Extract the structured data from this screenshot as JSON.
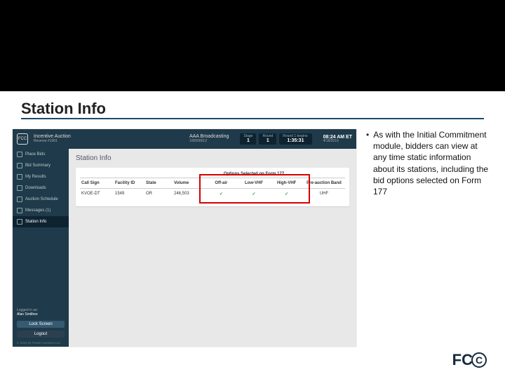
{
  "slide": {
    "heading": "Station Info",
    "bullet": "As with the Initial Commitment module, bidders can view at any time static information about its stations, including the bid options selected on Form 177"
  },
  "app": {
    "header": {
      "auction_name": "Incentive Auction",
      "auction_sub": "Reverse #1001",
      "bidder": "AAA Broadcasting",
      "bidder_sub": "100000012",
      "stage": {
        "label": "Stage",
        "value": "1"
      },
      "round": {
        "label": "Round",
        "value": "1"
      },
      "countdown": {
        "label": "Round 1 begins:",
        "value": "1:35:31"
      },
      "clock": {
        "value": "08:24 AM ET",
        "sub": "4/18/2016"
      }
    },
    "sidebar": {
      "items": [
        {
          "label": "Place Bids"
        },
        {
          "label": "Bid Summary"
        },
        {
          "label": "My Results"
        },
        {
          "label": "Downloads"
        },
        {
          "label": "Auction Schedule"
        },
        {
          "label": "Messages (1)"
        },
        {
          "label": "Station Info"
        }
      ],
      "logged_in_label": "Logged in as:",
      "logged_in_user": "Alan Smithee",
      "lock_btn": "Lock Screen",
      "logout_btn": "Logout",
      "footer": "© 2016 by Power Auctions LLC"
    },
    "main": {
      "title": "Station Info",
      "table": {
        "span_header": "Options Selected on Form 177",
        "headers": {
          "call_sign": "Call Sign",
          "facility_id": "Facility ID",
          "state": "State",
          "volume": "Volume",
          "off_air": "Off-air",
          "low_vhf": "Low-VHF",
          "high_vhf": "High-VHF",
          "pre_auction_band": "Pre-auction Band"
        },
        "rows": [
          {
            "call_sign": "KVOE-DT",
            "facility_id": "1549",
            "state": "OR",
            "volume": "246,503",
            "off_air": "✓",
            "low_vhf": "✓",
            "high_vhf": "✓",
            "pre_auction_band": "UHF"
          }
        ]
      }
    }
  }
}
